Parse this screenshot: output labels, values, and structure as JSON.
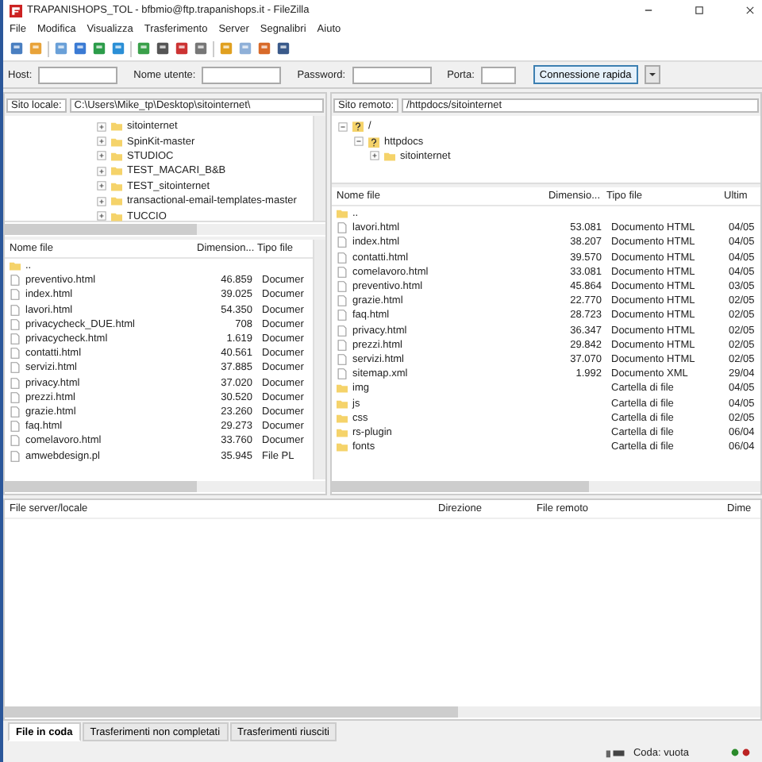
{
  "title_bar": {
    "title": "TRAPANISHOPS_TOL - bfbmio@ftp.trapanishops.it - FileZilla"
  },
  "menu": [
    "File",
    "Modifica",
    "Visualizza",
    "Trasferimento",
    "Server",
    "Segnalibri",
    "Aiuto"
  ],
  "quickconnect": {
    "host_label": "Host:",
    "username_label": "Nome utente:",
    "password_label": "Password:",
    "port_label": "Porta:",
    "button": "Connessione rapida"
  },
  "local": {
    "site_label": "Sito locale:",
    "path": "C:\\Users\\Mike_tp\\Desktop\\sitointernet\\",
    "tree": [
      {
        "name": "sitointernet",
        "expanded": false
      },
      {
        "name": "SpinKit-master",
        "expanded": false
      },
      {
        "name": "STUDIOC",
        "expanded": false
      },
      {
        "name": "TEST_MACARI_B&B",
        "expanded": false
      },
      {
        "name": "TEST_sitointernet",
        "expanded": false
      },
      {
        "name": "transactional-email-templates-master",
        "expanded": false
      },
      {
        "name": "TUCCIO",
        "expanded": false
      }
    ],
    "columns": [
      "Nome file",
      "Dimension...",
      "Tipo file"
    ],
    "files": [
      {
        "name": "..",
        "kind": "parent"
      },
      {
        "name": "preventivo.html",
        "size": "46.859",
        "type": "Documer",
        "kind": "file"
      },
      {
        "name": "index.html",
        "size": "39.025",
        "type": "Documer",
        "kind": "file"
      },
      {
        "name": "lavori.html",
        "size": "54.350",
        "type": "Documer",
        "kind": "file"
      },
      {
        "name": "privacycheck_DUE.html",
        "size": "708",
        "type": "Documer",
        "kind": "file"
      },
      {
        "name": "privacycheck.html",
        "size": "1.619",
        "type": "Documer",
        "kind": "file"
      },
      {
        "name": "contatti.html",
        "size": "40.561",
        "type": "Documer",
        "kind": "file"
      },
      {
        "name": "servizi.html",
        "size": "37.885",
        "type": "Documer",
        "kind": "file"
      },
      {
        "name": "privacy.html",
        "size": "37.020",
        "type": "Documer",
        "kind": "file"
      },
      {
        "name": "prezzi.html",
        "size": "30.520",
        "type": "Documer",
        "kind": "file"
      },
      {
        "name": "grazie.html",
        "size": "23.260",
        "type": "Documer",
        "kind": "file"
      },
      {
        "name": "faq.html",
        "size": "29.273",
        "type": "Documer",
        "kind": "file"
      },
      {
        "name": "comelavoro.html",
        "size": "33.760",
        "type": "Documer",
        "kind": "file"
      },
      {
        "name": "amwebdesign.pl",
        "size": "35.945",
        "type": "File PL",
        "kind": "file"
      }
    ]
  },
  "remote": {
    "site_label": "Sito remoto:",
    "path": "/httpdocs/sitointernet",
    "tree": [
      {
        "name": "/",
        "kind": "unknown",
        "expanded": true,
        "children": [
          {
            "name": "httpdocs",
            "kind": "unknown",
            "expanded": true,
            "children": [
              {
                "name": "sitointernet",
                "kind": "folder",
                "expanded": false
              }
            ]
          }
        ]
      }
    ],
    "columns": [
      "Nome file",
      "Dimensio...",
      "Tipo file",
      "Ultim"
    ],
    "files": [
      {
        "name": "..",
        "kind": "parent"
      },
      {
        "name": "lavori.html",
        "size": "53.081",
        "type": "Documento HTML",
        "date": "04/05",
        "kind": "file"
      },
      {
        "name": "index.html",
        "size": "38.207",
        "type": "Documento HTML",
        "date": "04/05",
        "kind": "file"
      },
      {
        "name": "contatti.html",
        "size": "39.570",
        "type": "Documento HTML",
        "date": "04/05",
        "kind": "file"
      },
      {
        "name": "comelavoro.html",
        "size": "33.081",
        "type": "Documento HTML",
        "date": "04/05",
        "kind": "file"
      },
      {
        "name": "preventivo.html",
        "size": "45.864",
        "type": "Documento HTML",
        "date": "03/05",
        "kind": "file"
      },
      {
        "name": "grazie.html",
        "size": "22.770",
        "type": "Documento HTML",
        "date": "02/05",
        "kind": "file"
      },
      {
        "name": "faq.html",
        "size": "28.723",
        "type": "Documento HTML",
        "date": "02/05",
        "kind": "file"
      },
      {
        "name": "privacy.html",
        "size": "36.347",
        "type": "Documento HTML",
        "date": "02/05",
        "kind": "file"
      },
      {
        "name": "prezzi.html",
        "size": "29.842",
        "type": "Documento HTML",
        "date": "02/05",
        "kind": "file"
      },
      {
        "name": "servizi.html",
        "size": "37.070",
        "type": "Documento HTML",
        "date": "02/05",
        "kind": "file"
      },
      {
        "name": "sitemap.xml",
        "size": "1.992",
        "type": "Documento XML",
        "date": "29/04",
        "kind": "file"
      },
      {
        "name": "img",
        "type": "Cartella di file",
        "date": "04/05",
        "kind": "folder"
      },
      {
        "name": "js",
        "type": "Cartella di file",
        "date": "04/05",
        "kind": "folder"
      },
      {
        "name": "css",
        "type": "Cartella di file",
        "date": "02/05",
        "kind": "folder"
      },
      {
        "name": "rs-plugin",
        "type": "Cartella di file",
        "date": "06/04",
        "kind": "folder"
      },
      {
        "name": "fonts",
        "type": "Cartella di file",
        "date": "06/04",
        "kind": "folder"
      }
    ]
  },
  "queue": {
    "columns": [
      "File server/locale",
      "Direzione",
      "File remoto",
      "Dime"
    ]
  },
  "tabs": [
    {
      "label": "File in coda",
      "selected": true
    },
    {
      "label": "Trasferimenti non completati",
      "selected": false
    },
    {
      "label": "Trasferimenti riusciti",
      "selected": false
    }
  ],
  "status": {
    "text": "Coda: vuota"
  }
}
